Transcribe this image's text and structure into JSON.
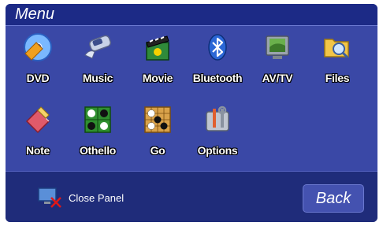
{
  "header": {
    "title": "Menu"
  },
  "menu": {
    "items": [
      {
        "label": "DVD",
        "icon": "dvd-icon"
      },
      {
        "label": "Music",
        "icon": "music-player-icon"
      },
      {
        "label": "Movie",
        "icon": "movie-clapper-icon"
      },
      {
        "label": "Bluetooth",
        "icon": "bluetooth-icon"
      },
      {
        "label": "AV/TV",
        "icon": "tv-icon"
      },
      {
        "label": "Files",
        "icon": "folder-search-icon"
      },
      {
        "label": "Note",
        "icon": "note-pencil-icon"
      },
      {
        "label": "Othello",
        "icon": "othello-board-icon"
      },
      {
        "label": "Go",
        "icon": "go-board-icon"
      },
      {
        "label": "Options",
        "icon": "tools-icon"
      }
    ]
  },
  "footer": {
    "close_label": "Close Panel",
    "close_icon": "close-panel-icon",
    "back_label": "Back"
  },
  "colors": {
    "panel": "#3a48a6",
    "titlebar": "#1c2a86",
    "bottom": "#1f2c7a",
    "text": "#ffffff"
  }
}
